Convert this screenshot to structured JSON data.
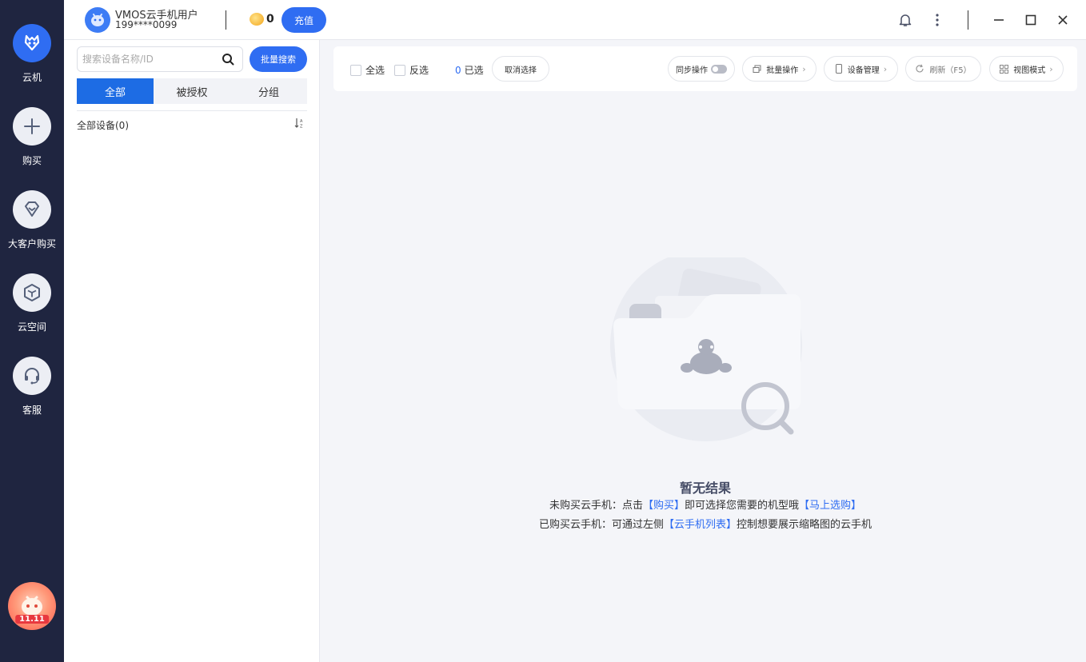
{
  "rail": {
    "items": [
      {
        "label": "云机",
        "icon": "cloud-phone-icon"
      },
      {
        "label": "购买",
        "icon": "plus-icon"
      },
      {
        "label": "大客户购买",
        "icon": "diamond-icon"
      },
      {
        "label": "云空间",
        "icon": "cube-icon"
      },
      {
        "label": "客服",
        "icon": "headset-icon"
      }
    ],
    "promo_tag": "11.11"
  },
  "topbar": {
    "user_name": "VMOS云手机用户",
    "user_phone": "199****0099",
    "coin_count": "0",
    "recharge_label": "充值"
  },
  "devpanel": {
    "search_placeholder": "搜索设备名称/ID",
    "batch_search_label": "批量搜索",
    "tabs": [
      "全部",
      "被授权",
      "分组"
    ],
    "all_devices": "全部设备(0)"
  },
  "toolbar": {
    "select_all": "全选",
    "invert": "反选",
    "selected_count": "0",
    "selected_suffix": "已选",
    "cancel_select": "取消选择",
    "sync_op": "同步操作",
    "batch_op": "批量操作",
    "device_mgmt": "设备管理",
    "refresh": "刷新（F5）",
    "view_mode": "视图模式"
  },
  "empty": {
    "title": "暂无结果",
    "line1_a": "未购买云手机：点击",
    "line1_link1": "【购买】",
    "line1_b": "即可选择您需要的机型哦",
    "line1_link2": "【马上选购】",
    "line2_a": "已购买云手机：可通过左侧",
    "line2_link": "【云手机列表】",
    "line2_b": "控制想要展示缩略图的云手机"
  },
  "colors": {
    "rail_bg": "#1f2540",
    "accent": "#2f6df2",
    "tab_active": "#1d6ce4"
  }
}
